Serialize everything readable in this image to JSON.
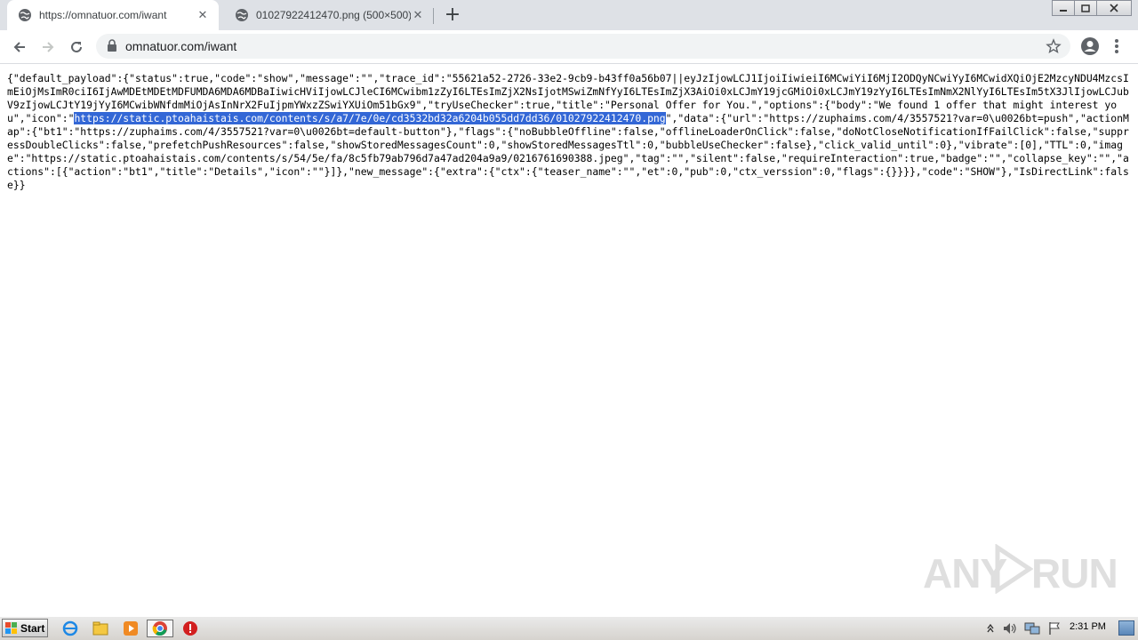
{
  "browser": {
    "tabs": [
      {
        "title": "https://omnatuor.com/iwant",
        "active": true
      },
      {
        "title": "01027922412470.png (500×500)",
        "active": false
      }
    ],
    "new_tab_label": "+",
    "address": "omnatuor.com/iwant"
  },
  "page": {
    "json_before_selection": "{\"default_payload\":{\"status\":true,\"code\":\"show\",\"message\":\"\",\"trace_id\":\"55621a52-2726-33e2-9cb9-b43ff0a56b07||eyJzIjowLCJ1IjoiIiwieiI6MCwiYiI6MjI2ODQyNCwiYyI6MCwidXQiOjE2MzcyNDU4MzcsImEiOjMsImR0ciI6IjAwMDEtMDEtMDFUMDA6MDA6MDBaIiwicHViIjowLCJleCI6MCwibm1zZyI6LTEsImZjX2NsIjotMSwiZmNfYyI6LTEsImZjX3AiOi0xLCJmY19jcGMiOi0xLCJmY19zYyI6LTEsImNmX2NlYyI6LTEsIm5tX3JlIjowLCJubV9zIjowLCJtY19jYyI6MCwibWNfdmMiOjAsInNrX2FuIjpmYWxzZSwiYXUiOm51bGx9\",\"tryUseChecker\":true,\"title\":\"Personal Offer for You.\",\"options\":{\"body\":\"We found 1 offer that might interest you\",\"icon\":\"",
    "json_selected": "https://static.ptoahaistais.com/contents/s/a7/7e/0e/cd3532bd32a6204b055dd7dd36/01027922412470.png",
    "json_after_selection": "\",\"data\":{\"url\":\"https://zuphaims.com/4/3557521?var=0\\u0026bt=push\",\"actionMap\":{\"bt1\":\"https://zuphaims.com/4/3557521?var=0\\u0026bt=default-button\"},\"flags\":{\"noBubbleOffline\":false,\"offlineLoaderOnClick\":false,\"doNotCloseNotificationIfFailClick\":false,\"suppressDoubleClicks\":false,\"prefetchPushResources\":false,\"showStoredMessagesCount\":0,\"showStoredMessagesTtl\":0,\"bubbleUseChecker\":false},\"click_valid_until\":0},\"vibrate\":[0],\"TTL\":0,\"image\":\"https://static.ptoahaistais.com/contents/s/54/5e/fa/8c5fb79ab796d7a47ad204a9a9/0216761690388.jpeg\",\"tag\":\"\",\"silent\":false,\"requireInteraction\":true,\"badge\":\"\",\"collapse_key\":\"\",\"actions\":[{\"action\":\"bt1\",\"title\":\"Details\",\"icon\":\"\"}]},\"new_message\":{\"extra\":{\"ctx\":{\"teaser_name\":\"\",\"et\":0,\"pub\":0,\"ctx_verssion\":0,\"flags\":{}}}},\"code\":\"SHOW\"},\"IsDirectLink\":false}}"
  },
  "taskbar": {
    "start_label": "Start",
    "clock": "2:31 PM"
  },
  "watermark": {
    "left": "ANY",
    "right": "RUN"
  },
  "colors": {
    "selection": "#3367d6",
    "tabstrip": "#dee1e6",
    "omnibox": "#f1f3f4"
  }
}
